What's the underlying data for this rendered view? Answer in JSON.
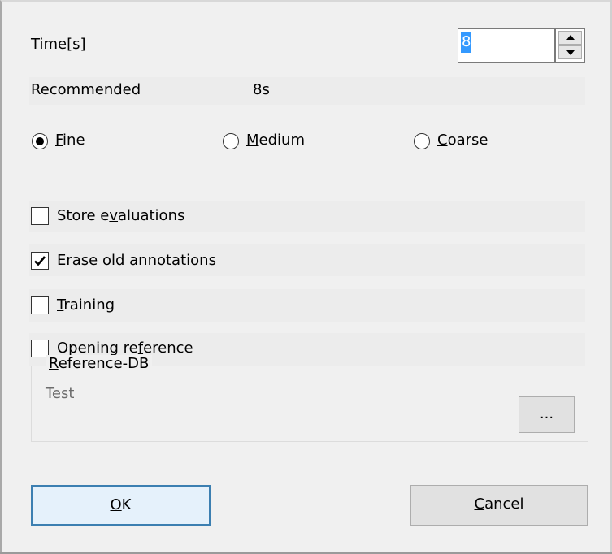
{
  "time": {
    "label_mn": "T",
    "label_rest": "ime[s]",
    "value": "8"
  },
  "recommended": {
    "label": "Recommended",
    "value": "8s"
  },
  "resolution": {
    "options": [
      {
        "mn": "F",
        "rest": "ine",
        "selected": true
      },
      {
        "mn": "M",
        "rest": "edium",
        "selected": false
      },
      {
        "mn": "C",
        "rest": "oarse",
        "selected": false
      }
    ]
  },
  "checkboxes": [
    {
      "pre": "Store e",
      "mn": "v",
      "post": "aluations",
      "checked": false
    },
    {
      "pre": "",
      "mn": "E",
      "post": "rase old annotations",
      "checked": true
    },
    {
      "pre": "",
      "mn": "T",
      "post": "raining",
      "checked": false
    },
    {
      "pre": "Opening re",
      "mn": "f",
      "post": "erence",
      "checked": false
    }
  ],
  "reference_db": {
    "legend_mn": "R",
    "legend_rest": "eference-DB",
    "value": "Test",
    "browse_label": "..."
  },
  "buttons": {
    "ok_mn": "O",
    "ok_rest": "K",
    "cancel_mn": "C",
    "cancel_rest": "ancel"
  },
  "colors": {
    "accent": "#3399ff",
    "focus_border": "#3c7fb1",
    "background": "#f0f0f0"
  }
}
